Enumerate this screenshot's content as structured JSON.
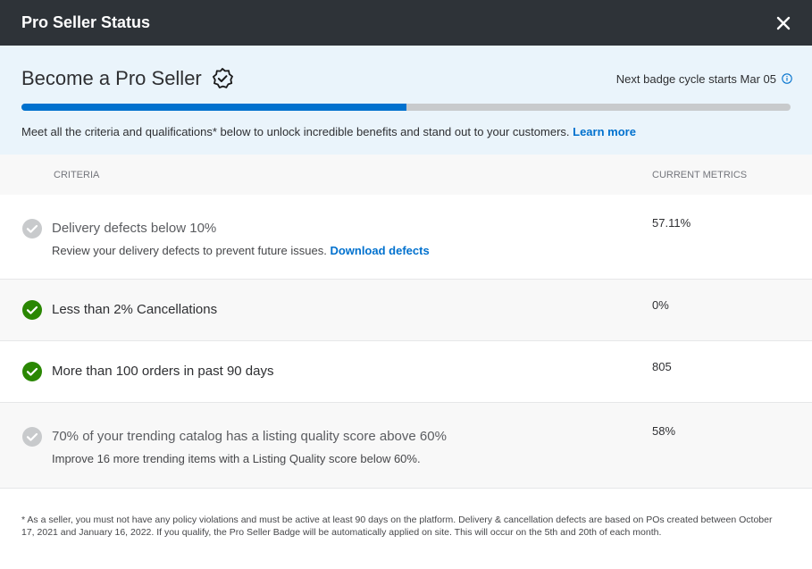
{
  "modal": {
    "title": "Pro Seller Status"
  },
  "hero": {
    "title": "Become a Pro Seller",
    "cycle_text": "Next badge cycle starts Mar 05",
    "progress_fraction": 0.5,
    "description": "Meet all the criteria and qualifications* below to unlock incredible benefits and stand out to your customers.",
    "learn_more": "Learn more"
  },
  "table": {
    "headers": {
      "criteria": "CRITERIA",
      "metrics": "CURRENT METRICS"
    },
    "rows": [
      {
        "status": "unmet",
        "title": "Delivery defects below 10%",
        "subtitle": "Review your delivery defects to prevent future issues.",
        "link": "Download defects",
        "metric": "57.11%"
      },
      {
        "status": "met",
        "title": "Less than 2% Cancellations",
        "metric": "0%"
      },
      {
        "status": "met",
        "title": "More than 100 orders in past 90 days",
        "metric": "805"
      },
      {
        "status": "unmet",
        "title": "70% of your trending catalog has a listing quality score above 60%",
        "subtitle": "Improve 16 more trending items with a Listing Quality score below 60%.",
        "metric": "58%"
      }
    ]
  },
  "footnote": "* As a seller, you must not have any policy violations and must be active at least 90 days on the platform. Delivery & cancellation defects are based on POs created between October 17, 2021 and January 16, 2022. If you qualify, the Pro Seller Badge will be automatically applied on site. This will occur on the 5th and 20th of each month.",
  "colors": {
    "header_bg": "#2e3338",
    "hero_bg": "#eaf4fb",
    "accent": "#0071ce",
    "met_green": "#2a8703",
    "unmet_gray": "#c8cacc"
  },
  "icons": {
    "close": "close-icon",
    "badge": "badge-check-icon",
    "info": "info-icon",
    "met": "check-circle-filled-icon",
    "unmet": "check-circle-gray-icon"
  }
}
